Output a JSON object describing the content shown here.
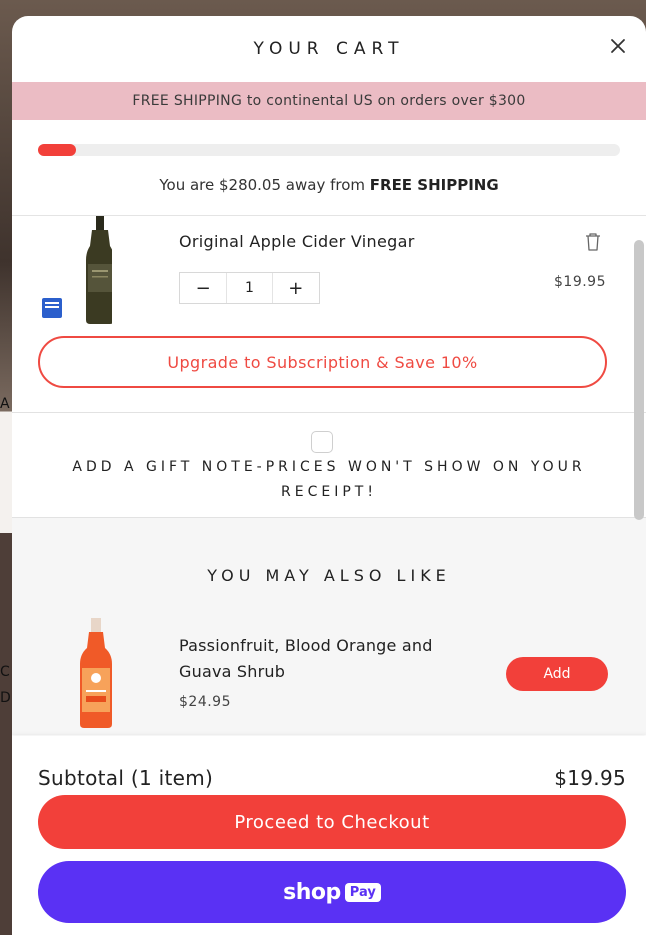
{
  "background": {
    "edge_letters": [
      "A",
      "C",
      "D"
    ]
  },
  "cart": {
    "title": "YOUR CART",
    "close_icon": "close-icon",
    "banner": "FREE SHIPPING to continental US on orders over $300",
    "progress": {
      "fraction": 0.066,
      "prefix": "You are $280.05 away from ",
      "emphasis": "FREE SHIPPING"
    },
    "line_item": {
      "title": "Original Apple Cider Vinegar",
      "quantity": "1",
      "decrement": "−",
      "increment": "+",
      "price": "$19.95",
      "upgrade_label": "Upgrade to Subscription & Save 10%"
    },
    "gift_note": {
      "text": "ADD A GIFT NOTE-PRICES WON'T SHOW ON YOUR RECEIPT!"
    },
    "upsell": {
      "title": "YOU MAY ALSO LIKE",
      "product_name": "Passionfruit, Blood Orange and Guava Shrub",
      "price": "$24.95",
      "add_label": "Add"
    },
    "footer": {
      "subtotal_label": "Subtotal (1 item)",
      "subtotal_value": "$19.95",
      "checkout_label": "Proceed to Checkout",
      "shoppay_shop": "shop",
      "shoppay_pay": "Pay"
    }
  },
  "colors": {
    "accent": "#f2403a",
    "banner": "#ebbcc4",
    "shoppay": "#5a31f4"
  }
}
